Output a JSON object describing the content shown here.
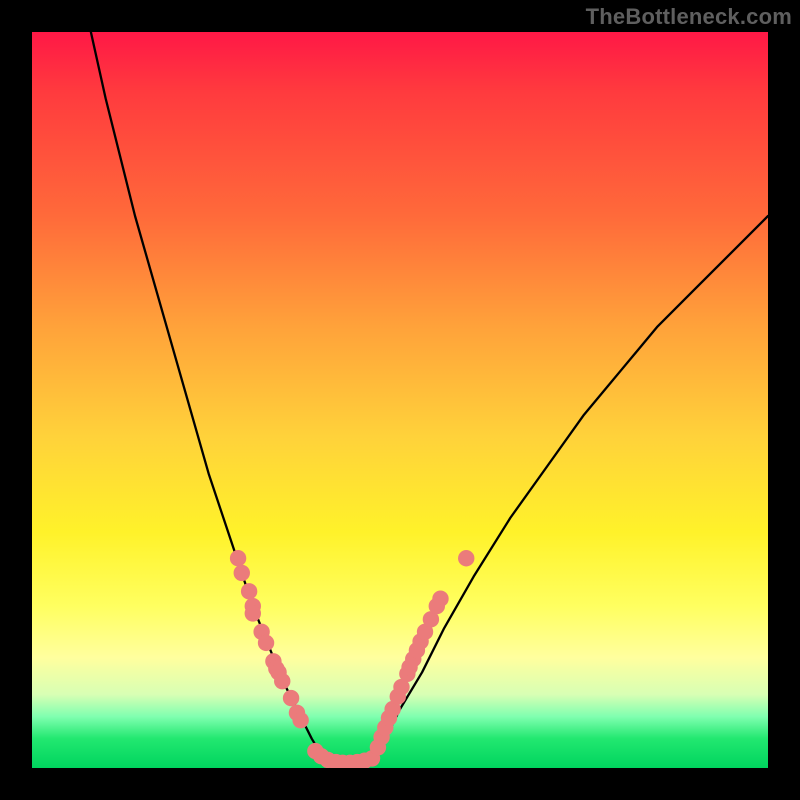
{
  "watermark": "TheBottleneck.com",
  "chart_data": {
    "type": "line",
    "title": "",
    "xlabel": "",
    "ylabel": "",
    "xlim": [
      0,
      100
    ],
    "ylim": [
      0,
      100
    ],
    "grid": false,
    "legend": false,
    "series": [
      {
        "name": "left-curve",
        "x": [
          8,
          10,
          12,
          14,
          16,
          18,
          20,
          22,
          24,
          26,
          28,
          30,
          32,
          34,
          36,
          38,
          39.5
        ],
        "y": [
          100,
          91,
          83,
          75,
          68,
          61,
          54,
          47,
          40,
          34,
          28,
          22,
          17,
          12,
          8,
          4,
          1.5
        ]
      },
      {
        "name": "valley-floor",
        "x": [
          39.5,
          41,
          43,
          45,
          46.5
        ],
        "y": [
          1.5,
          0.8,
          0.6,
          0.8,
          1.4
        ]
      },
      {
        "name": "right-curve",
        "x": [
          46.5,
          48,
          50,
          53,
          56,
          60,
          65,
          70,
          75,
          80,
          85,
          90,
          95,
          100
        ],
        "y": [
          1.4,
          4,
          8,
          13,
          19,
          26,
          34,
          41,
          48,
          54,
          60,
          65,
          70,
          75
        ]
      }
    ],
    "marker_groups": [
      {
        "name": "left-cluster",
        "color": "#eb7b7b",
        "points": [
          {
            "x": 28,
            "y": 28.5
          },
          {
            "x": 28.5,
            "y": 26.5
          },
          {
            "x": 29.5,
            "y": 24
          },
          {
            "x": 30,
            "y": 22
          },
          {
            "x": 30,
            "y": 21
          },
          {
            "x": 31.2,
            "y": 18.5
          },
          {
            "x": 31.8,
            "y": 17
          },
          {
            "x": 32.8,
            "y": 14.5
          },
          {
            "x": 33.2,
            "y": 13.5
          },
          {
            "x": 33.5,
            "y": 13
          },
          {
            "x": 34,
            "y": 11.8
          },
          {
            "x": 35.2,
            "y": 9.5
          },
          {
            "x": 36,
            "y": 7.5
          },
          {
            "x": 36.5,
            "y": 6.5
          }
        ]
      },
      {
        "name": "bottom-cluster",
        "color": "#eb7b7b",
        "points": [
          {
            "x": 38.5,
            "y": 2.3
          },
          {
            "x": 39.3,
            "y": 1.6
          },
          {
            "x": 40.2,
            "y": 1.1
          },
          {
            "x": 41.3,
            "y": 0.8
          },
          {
            "x": 42.2,
            "y": 0.7
          },
          {
            "x": 43.2,
            "y": 0.7
          },
          {
            "x": 44.2,
            "y": 0.8
          },
          {
            "x": 45.2,
            "y": 1.0
          },
          {
            "x": 46.2,
            "y": 1.3
          }
        ]
      },
      {
        "name": "right-cluster",
        "color": "#eb7b7b",
        "points": [
          {
            "x": 47,
            "y": 2.8
          },
          {
            "x": 47.5,
            "y": 4.2
          },
          {
            "x": 48,
            "y": 5.5
          },
          {
            "x": 48.5,
            "y": 6.8
          },
          {
            "x": 49,
            "y": 8.0
          },
          {
            "x": 49.7,
            "y": 9.7
          },
          {
            "x": 50.2,
            "y": 11.0
          },
          {
            "x": 51,
            "y": 12.8
          },
          {
            "x": 51.3,
            "y": 13.7
          },
          {
            "x": 51.8,
            "y": 14.8
          },
          {
            "x": 52.3,
            "y": 16.0
          },
          {
            "x": 52.8,
            "y": 17.2
          },
          {
            "x": 53.4,
            "y": 18.5
          },
          {
            "x": 54.2,
            "y": 20.2
          },
          {
            "x": 55,
            "y": 22
          },
          {
            "x": 55.5,
            "y": 23
          },
          {
            "x": 59,
            "y": 28.5
          }
        ]
      }
    ]
  }
}
